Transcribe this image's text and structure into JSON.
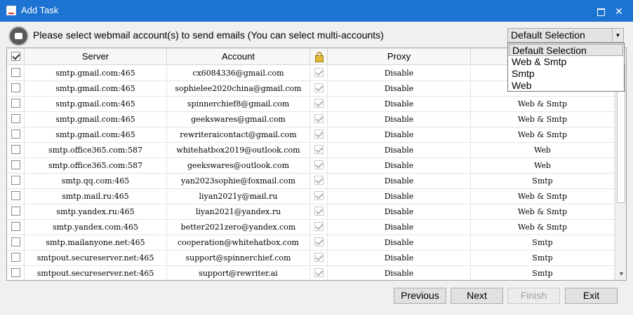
{
  "window": {
    "title": "Add Task"
  },
  "instruction": "Please select webmail account(s) to send emails (You can select multi-accounts)",
  "dropdown": {
    "selected": "Default Selection",
    "options": [
      "Default Selection",
      "Web & Smtp",
      "Smtp",
      "Web"
    ]
  },
  "table": {
    "headers": {
      "server": "Server",
      "account": "Account",
      "proxy": "Proxy"
    },
    "rows": [
      {
        "server": "smtp.gmail.com:465",
        "account": "cx6084336@gmail.com",
        "proxy": "Disable",
        "type": ""
      },
      {
        "server": "smtp.gmail.com:465",
        "account": "sophielee2020china@gmail.com",
        "proxy": "Disable",
        "type": ""
      },
      {
        "server": "smtp.gmail.com:465",
        "account": "spinnerchief8@gmail.com",
        "proxy": "Disable",
        "type": "Web & Smtp"
      },
      {
        "server": "smtp.gmail.com:465",
        "account": "geekswares@gmail.com",
        "proxy": "Disable",
        "type": "Web & Smtp"
      },
      {
        "server": "smtp.gmail.com:465",
        "account": "rewriteraicontact@gmail.com",
        "proxy": "Disable",
        "type": "Web & Smtp"
      },
      {
        "server": "smtp.office365.com:587",
        "account": "whitehatbox2019@outlook.com",
        "proxy": "Disable",
        "type": "Web"
      },
      {
        "server": "smtp.office365.com:587",
        "account": "geekswares@outlook.com",
        "proxy": "Disable",
        "type": "Web"
      },
      {
        "server": "smtp.qq.com:465",
        "account": "yan2023sophie@foxmail.com",
        "proxy": "Disable",
        "type": "Smtp"
      },
      {
        "server": "smtp.mail.ru:465",
        "account": "liyan2021y@mail.ru",
        "proxy": "Disable",
        "type": "Web & Smtp"
      },
      {
        "server": "smtp.yandex.ru:465",
        "account": "liyan2021@yandex.ru",
        "proxy": "Disable",
        "type": "Web & Smtp"
      },
      {
        "server": "smtp.yandex.com:465",
        "account": "better2021zero@yandex.com",
        "proxy": "Disable",
        "type": "Web & Smtp"
      },
      {
        "server": "smtp.mailanyone.net:465",
        "account": "cooperation@whitehatbox.com",
        "proxy": "Disable",
        "type": "Smtp"
      },
      {
        "server": "smtpout.secureserver.net:465",
        "account": "support@spinnerchief.com",
        "proxy": "Disable",
        "type": "Smtp"
      },
      {
        "server": "smtpout.secureserver.net:465",
        "account": "support@rewriter.ai",
        "proxy": "Disable",
        "type": "Smtp"
      }
    ]
  },
  "buttons": {
    "previous": "Previous",
    "next": "Next",
    "finish": "Finish",
    "exit": "Exit"
  },
  "icons": {
    "close": "✕",
    "scroll_down": "▼",
    "dropdown_arrow": "▼"
  }
}
